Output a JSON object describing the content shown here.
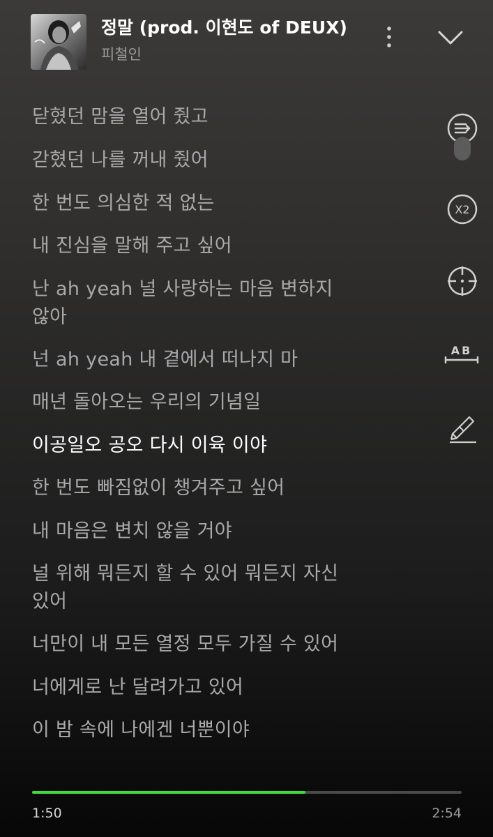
{
  "header": {
    "title": "정말 (prod. 이현도 of DEUX)",
    "artist": "피철인"
  },
  "lyrics": {
    "top_partial": "",
    "lines": [
      "닫혔던 맘을 열어 줬고",
      "갇혔던 나를 꺼내 줬어",
      "한 번도 의심한 적 없는",
      "내 진심을 말해 주고 싶어",
      "난 ah yeah 널 사랑하는 마음 변하지",
      "않아",
      "넌 ah yeah 내 곁에서 떠나지 마",
      "매년 돌아오는 우리의 기념일",
      "이공일오 공오 다시 이육 이야",
      "한 번도 빠짐없이 챙겨주고 싶어",
      "내 마음은 변치 않을 거야",
      "널 위해 뭐든지 할 수 있어 뭐든지 자신",
      "있어",
      "너만이 내 모든 열정 모두 가질 수 있어",
      "너에게로 난 달려가고 있어",
      "이 밤 속에 나에겐 너뿐이야"
    ],
    "bottom_partial": "",
    "current_index": 8
  },
  "side_controls": {
    "speed_label": "X2",
    "ab_label": "AB"
  },
  "icons": {
    "more": "more-vertical-icon",
    "collapse": "chevron-down-icon",
    "lyrics_scroll": "lyrics-scroll-icon",
    "speed": "playback-speed-icon",
    "locate": "crosshair-icon",
    "ab_repeat": "ab-repeat-icon",
    "edit": "edit-lyrics-icon"
  },
  "player": {
    "elapsed": "1:50",
    "total": "2:54",
    "progress": 0.637
  },
  "colors": {
    "accent": "#3ddc3d",
    "current_lyric": "#ffffff",
    "lyric": "#a9a9a9"
  }
}
